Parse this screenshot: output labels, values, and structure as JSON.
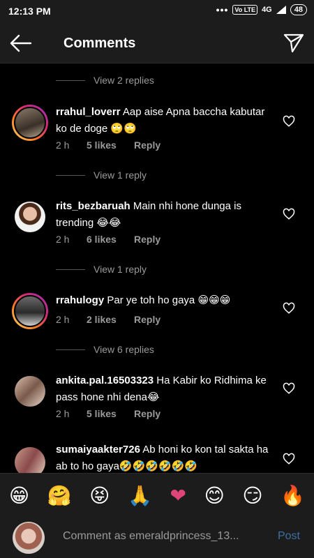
{
  "status_bar": {
    "time": "12:13 PM",
    "dots": "•••",
    "volte": "Vo LTE",
    "network": "4G",
    "battery": "48"
  },
  "header": {
    "title": "Comments",
    "back_icon": "arrow-left-icon",
    "send_icon": "paper-plane-icon"
  },
  "feed": {
    "view_replies": [
      "View 2 replies",
      "View 1 reply",
      "View 1 reply",
      "View 6 replies"
    ],
    "comments": [
      {
        "username": "rrahul_loverr",
        "text": "Aap aise Apna baccha kabutar ko de doge 🙄🙄",
        "time": "2 h",
        "likes": "5 likes",
        "reply": "Reply"
      },
      {
        "username": "rits_bezbaruah",
        "text": "Main nhi hone dunga is trending 😂😂",
        "time": "2 h",
        "likes": "6 likes",
        "reply": "Reply"
      },
      {
        "username": "rrahulogy",
        "text": "Par ye toh ho gaya 😁😁😁",
        "time": "2 h",
        "likes": "2 likes",
        "reply": "Reply"
      },
      {
        "username": "ankita.pal.16503323",
        "text": "Ha Kabir ko Ridhima ke pass hone nhi dena😂",
        "time": "2 h",
        "likes": "5 likes",
        "reply": "Reply"
      },
      {
        "username": "sumaiyaakter726",
        "text": "Ab honi ko kon tal sakta ha ab to ho gaya🤣🤣🤣🤣🤣🤣",
        "time": "",
        "likes": "",
        "reply": ""
      }
    ]
  },
  "emoji_bar": [
    "😁",
    "🤗",
    "😝",
    "🙏",
    "❤",
    "😊",
    "😏",
    "🔥"
  ],
  "composer": {
    "placeholder": "Comment as emeraldprincess_13...",
    "post_label": "Post"
  },
  "colors": {
    "background": "#000000",
    "bar": "#1c1c1c",
    "secondary_text": "#9a9a9a",
    "post_link": "#3d6fa3"
  }
}
